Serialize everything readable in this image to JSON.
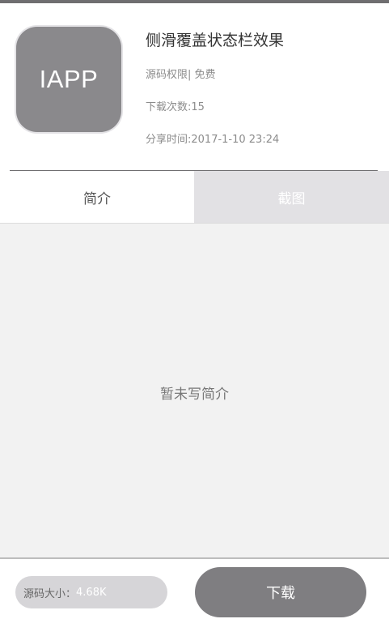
{
  "app": {
    "icon_text": "IAPP",
    "title": "侧滑覆盖状态栏效果",
    "permission": "源码权限| 免费",
    "downloads": "下载次数:15",
    "share_time": "分享时间:2017-1-10 23:24"
  },
  "tabs": [
    {
      "label": "简介",
      "selected": true
    },
    {
      "label": "截图",
      "selected": false
    }
  ],
  "content": {
    "empty_text": "暂未写简介"
  },
  "footer": {
    "size_label": "源码大小：",
    "size_value": "4.68K",
    "download_label": "下载"
  },
  "colors": {
    "icon_bg": "#8a898c",
    "tab_inactive_bg": "#e2e1e4",
    "content_bg": "#f2f2f2",
    "download_button": "#7f7e81",
    "size_pill": "#d6d5d8"
  }
}
